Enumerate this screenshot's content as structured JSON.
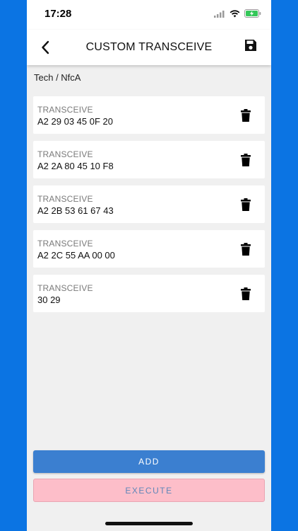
{
  "status_bar": {
    "time": "17:28",
    "icons": [
      "signal-icon",
      "wifi-icon",
      "battery-charging-icon"
    ],
    "battery_color": "#34c759"
  },
  "nav": {
    "title": "CUSTOM TRANSCEIVE",
    "back_icon": "chevron-left-icon",
    "save_icon": "save-icon"
  },
  "breadcrumb": "Tech / NfcA",
  "commands": [
    {
      "type": "TRANSCEIVE",
      "hex": "A2 29 03 45 0F 20"
    },
    {
      "type": "TRANSCEIVE",
      "hex": "A2 2A 80 45 10 F8"
    },
    {
      "type": "TRANSCEIVE",
      "hex": "A2 2B 53 61 67 43"
    },
    {
      "type": "TRANSCEIVE",
      "hex": "A2 2C 55 AA 00 00"
    },
    {
      "type": "TRANSCEIVE",
      "hex": "30 29"
    }
  ],
  "buttons": {
    "add_label": "ADD",
    "execute_label": "EXECUTE"
  },
  "colors": {
    "frame": "#0b74e3",
    "background": "#f0f0f0",
    "add_button": "#3b7fd0",
    "execute_button": "#fdbec9",
    "execute_text": "#5f86b9"
  }
}
